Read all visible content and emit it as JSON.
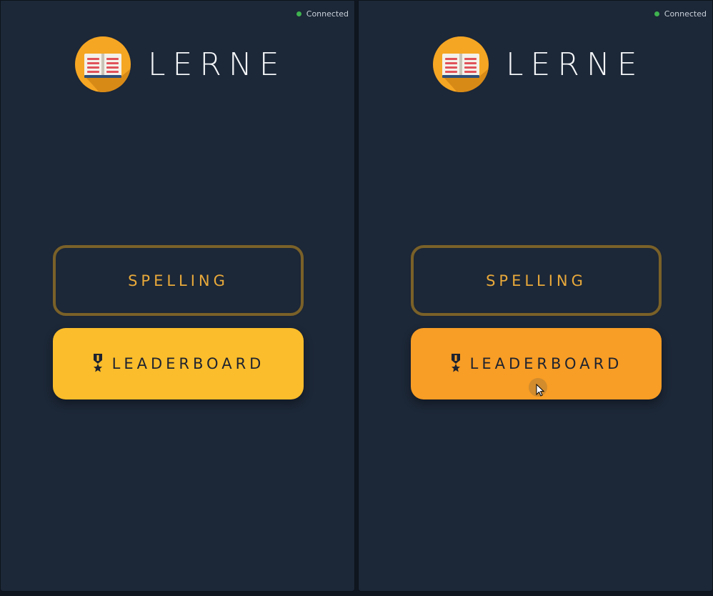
{
  "panels": [
    {
      "status": {
        "label": "Connected",
        "color": "#3fb24f"
      },
      "logo": {
        "title": "LERNE",
        "icon": "open-book-icon"
      },
      "buttons": {
        "spelling": "SPELLING",
        "leaderboard": "LEADERBOARD",
        "leaderboard_icon": "medal-icon"
      }
    },
    {
      "status": {
        "label": "Connected",
        "color": "#3fb24f"
      },
      "logo": {
        "title": "LERNE",
        "icon": "open-book-icon"
      },
      "buttons": {
        "spelling": "SPELLING",
        "leaderboard": "LEADERBOARD",
        "leaderboard_icon": "medal-icon"
      }
    }
  ],
  "colors": {
    "background": "#1c2737",
    "accent": "#fbbd2b",
    "accent_hover": "#f89d25",
    "outline": "#7a6128",
    "outline_text": "#e8a93a"
  }
}
